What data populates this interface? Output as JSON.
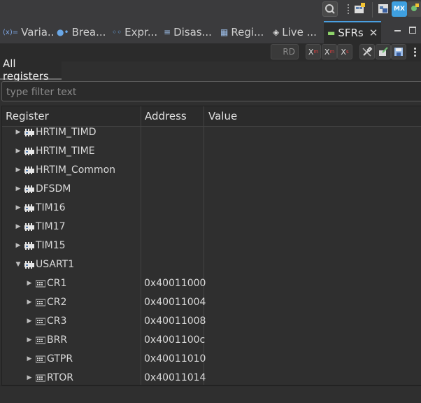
{
  "tabs": [
    {
      "label": "Varia...",
      "icon": "variables-icon",
      "glyph": "(x)="
    },
    {
      "label": "Brea...",
      "icon": "breakpoints-icon",
      "glyph": "●•"
    },
    {
      "label": "Expr...",
      "icon": "expressions-icon",
      "glyph": "◦◦"
    },
    {
      "label": "Disas...",
      "icon": "disassembly-icon",
      "glyph": "≡"
    },
    {
      "label": "Regi...",
      "icon": "registers-icon",
      "glyph": "▦"
    },
    {
      "label": "Live ...",
      "icon": "live-expressions-icon",
      "glyph": "◈"
    },
    {
      "label": "SFRs",
      "icon": "sfrs-icon",
      "glyph": "▬"
    }
  ],
  "toolbar": {
    "rd_label": "RD"
  },
  "subtab": {
    "label": "All registers"
  },
  "filter": {
    "placeholder": "type filter text"
  },
  "table": {
    "columns": [
      "Register",
      "Address",
      "Value"
    ],
    "rows": [
      {
        "name": "HRTIM_TIMD",
        "address": "",
        "expanded": false,
        "level": 0
      },
      {
        "name": "HRTIM_TIME",
        "address": "",
        "expanded": false,
        "level": 0
      },
      {
        "name": "HRTIM_Common",
        "address": "",
        "expanded": false,
        "level": 0
      },
      {
        "name": "DFSDM",
        "address": "",
        "expanded": false,
        "level": 0
      },
      {
        "name": "TIM16",
        "address": "",
        "expanded": false,
        "level": 0
      },
      {
        "name": "TIM17",
        "address": "",
        "expanded": false,
        "level": 0
      },
      {
        "name": "TIM15",
        "address": "",
        "expanded": false,
        "level": 0
      },
      {
        "name": "USART1",
        "address": "",
        "expanded": true,
        "level": 0
      },
      {
        "name": "CR1",
        "address": "0x40011000",
        "expanded": false,
        "level": 1
      },
      {
        "name": "CR2",
        "address": "0x40011004",
        "expanded": false,
        "level": 1
      },
      {
        "name": "CR3",
        "address": "0x40011008",
        "expanded": false,
        "level": 1
      },
      {
        "name": "BRR",
        "address": "0x4001100c",
        "expanded": false,
        "level": 1
      },
      {
        "name": "GTPR",
        "address": "0x40011010",
        "expanded": false,
        "level": 1
      },
      {
        "name": "RTOR",
        "address": "0x40011014",
        "expanded": false,
        "level": 1
      }
    ]
  },
  "colors": {
    "accent": "#4a9fe0",
    "bg": "#2f2f2f"
  }
}
